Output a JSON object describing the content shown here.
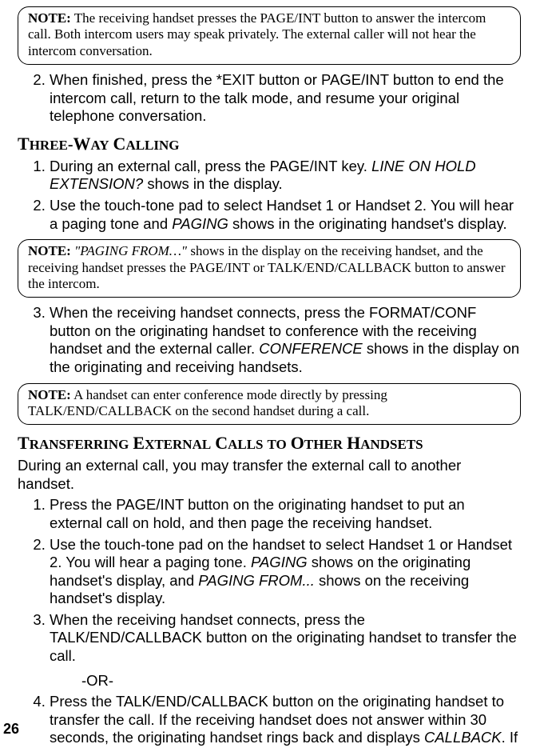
{
  "note1": {
    "label": "NOTE:",
    "text": " The receiving handset presses the PAGE/INT  button to answer the intercom call. Both intercom users may speak privately. The external caller will not hear the intercom conversation."
  },
  "item_a2": "When finished, press the *EXIT button or PAGE/INT button to end the intercom call, return to the talk mode, and resume your original telephone conversation.",
  "heading1": "Three-Way Calling",
  "item_b1_a": "During an external call, press the PAGE/INT key. ",
  "item_b1_b": "LINE ON HOLD EXTENSION?",
  "item_b1_c": " shows in the display.",
  "item_b2_a": "Use the touch-tone pad to select Handset 1 or Handset 2. You will hear a paging tone and ",
  "item_b2_b": "PAGING",
  "item_b2_c": " shows in the originating handset's display.",
  "note2": {
    "label": "NOTE:",
    "quote": " \"PAGING FROM…\"",
    "rest": " shows in the display on the receiving handset, and the receiving handset presses the PAGE/INT or TALK/END/CALLBACK button to answer the intercom."
  },
  "item_b3_a": "When the receiving handset connects, press the FORMAT/CONF button on the originating handset to conference with the receiving handset and the external caller. ",
  "item_b3_b": "CONFERENCE",
  "item_b3_c": " shows in the display on the originating and receiving handsets.",
  "note3": {
    "label": "NOTE:",
    "text": " A handset can enter conference mode directly by pressing TALK/END/CALLBACK on the second handset during a call."
  },
  "heading2": "Transferring External Calls to Other Handsets",
  "para_t": "During an external call, you may transfer the external call to another handset.",
  "item_c1": "Press the PAGE/INT button on the originating handset to put an external call on hold, and then page the receiving handset.",
  "item_c2_a": "Use the touch-tone pad on the handset to select Handset 1 or Handset 2. You will hear a paging tone. ",
  "item_c2_b": "PAGING",
  "item_c2_c": " shows on the originating handset's display, and ",
  "item_c2_d": "PAGING FROM...",
  "item_c2_e": " shows on the receiving handset's display.",
  "item_c3": "When the receiving handset connects, press the TALK/END/CALLBACK button on the originating handset to transfer the call.",
  "or": "-OR-",
  "item_c4_a": "Press the TALK/END/CALLBACK button on the originating handset to transfer the call. If the receiving handset does not answer within 30 seconds, the originating handset rings back and displays ",
  "item_c4_b": "CALLBACK",
  "item_c4_c": ". If",
  "page_num": "26"
}
